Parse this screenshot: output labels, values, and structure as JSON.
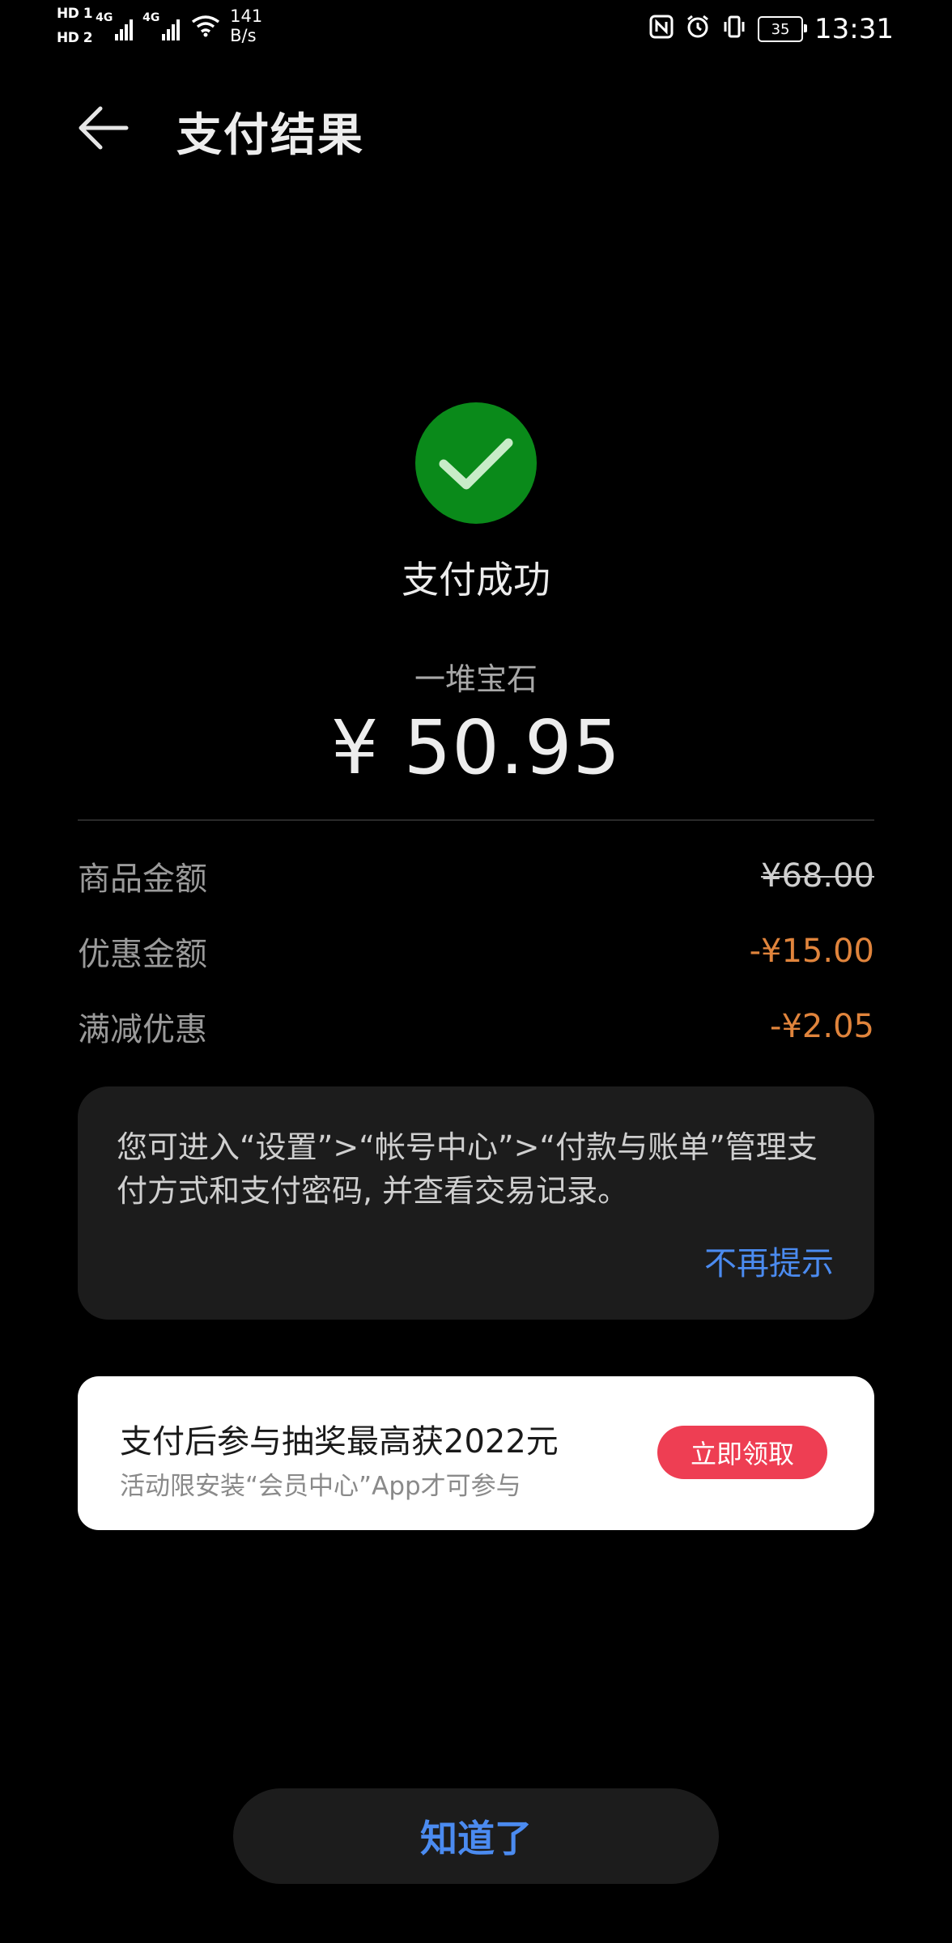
{
  "status_bar": {
    "sim1_label": "HD 1",
    "sim2_label": "HD 2",
    "network1": "4G",
    "network2": "4G",
    "speed_value": "141",
    "speed_unit": "B/s",
    "battery": "35",
    "time": "13:31",
    "icons": [
      "nfc-icon",
      "alarm-icon",
      "vibrate-icon"
    ]
  },
  "header": {
    "title": "支付结果",
    "back_icon": "arrow-left-icon"
  },
  "result": {
    "icon": "check-circle-icon",
    "icon_color": "#0a8a1a",
    "status": "支付成功",
    "merchant": "一堆宝石",
    "amount": "¥ 50.95"
  },
  "details": [
    {
      "label": "商品金额",
      "value": "¥68.00"
    },
    {
      "label": "优惠金额",
      "value": "-¥15.00"
    },
    {
      "label": "满减优惠",
      "value": "-¥2.05"
    }
  ],
  "info_card": {
    "text": "您可进入“设置”>“帐号中心”>“付款与账单”管理支付方式和支付密码, 并查看交易记录。",
    "dismiss": "不再提示"
  },
  "promo": {
    "title": "支付后参与抽奖最高获2022元",
    "subtitle": "活动限安装“会员中心”App才可参与",
    "button": "立即领取",
    "button_color": "#ee3e53"
  },
  "ok_button": "知道了",
  "accent_color": "#4b8bf0",
  "discount_color": "#e0843c"
}
